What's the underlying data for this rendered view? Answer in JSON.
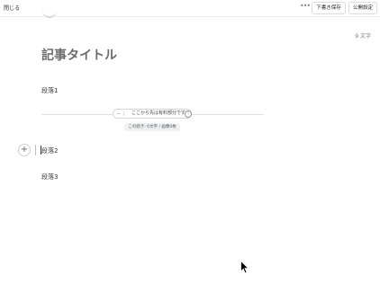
{
  "header": {
    "close_label": "閉じる",
    "more_icon": "more-horizontal-icon",
    "save_draft_label": "下書き保存",
    "publish_settings_label": "公開設定"
  },
  "editor": {
    "char_count": "9 文字",
    "title": "記事タイトル",
    "paragraphs": [
      "段落1",
      "段落2",
      "段落3"
    ],
    "paywall": {
      "minus_icon": "minus-icon",
      "label": "ここから先は有料部分です",
      "help_icon": "help-circle-icon",
      "info": "この続き: 6文字 / 画像0枚"
    },
    "add_block_icon": "plus-icon"
  }
}
